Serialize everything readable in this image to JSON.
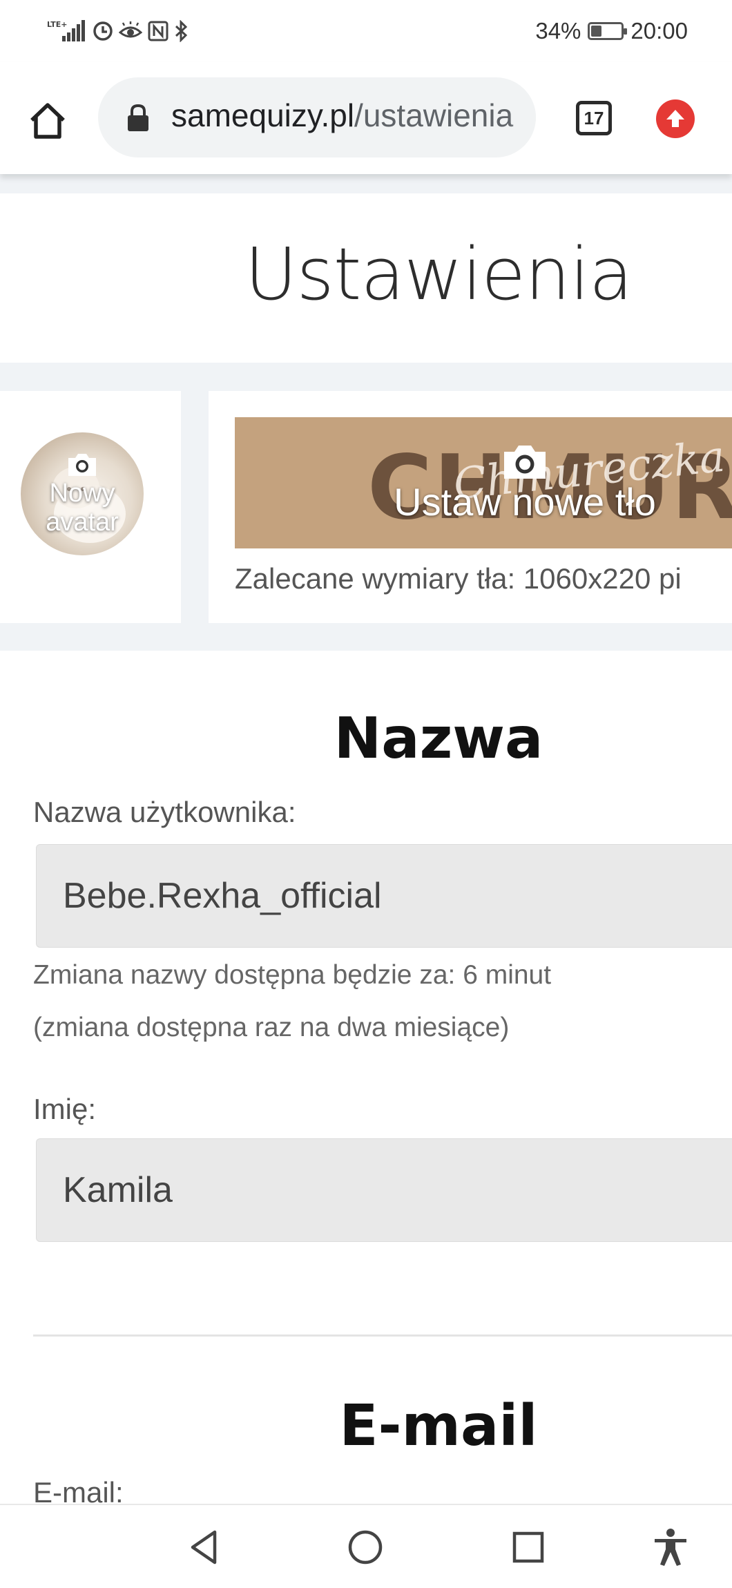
{
  "status_bar": {
    "network": "LTE+",
    "battery_percent": "34%",
    "battery_level": 0.34,
    "time": "20:00",
    "icons": [
      "signal-icon",
      "data-saver-icon",
      "eye-comfort-icon",
      "nfc-icon",
      "bluetooth-icon",
      "battery-icon"
    ]
  },
  "browser": {
    "url_domain": "samequizy.pl",
    "url_path": "/ustawienia",
    "tab_count": "17"
  },
  "page": {
    "title": "Ustawienia",
    "avatar": {
      "label": "Nowy avatar"
    },
    "background": {
      "banner_text": "CHMURECZKA",
      "banner_script": "Chmureczka",
      "label": "Ustaw nowe tło",
      "hint": "Zalecane wymiary tła: 1060x220 pi"
    },
    "sections": {
      "name": {
        "title": "Nazwa",
        "username_label": "Nazwa użytkownika:",
        "username_value": "Bebe.Rexha_official",
        "change_note": "Zmiana nazwy dostępna będzie za: 6 minut",
        "frequency_note": "(zmiana dostępna raz na dwa miesiące)",
        "first_name_label": "Imię:",
        "first_name_value": "Kamila"
      },
      "email": {
        "title": "E-mail",
        "email_label": "E-mail:"
      }
    }
  },
  "colors": {
    "page_bg": "#f0f3f6",
    "input_bg": "#e9e9e9",
    "update_badge": "#e53935",
    "banner_bg": "#c4a27e"
  }
}
